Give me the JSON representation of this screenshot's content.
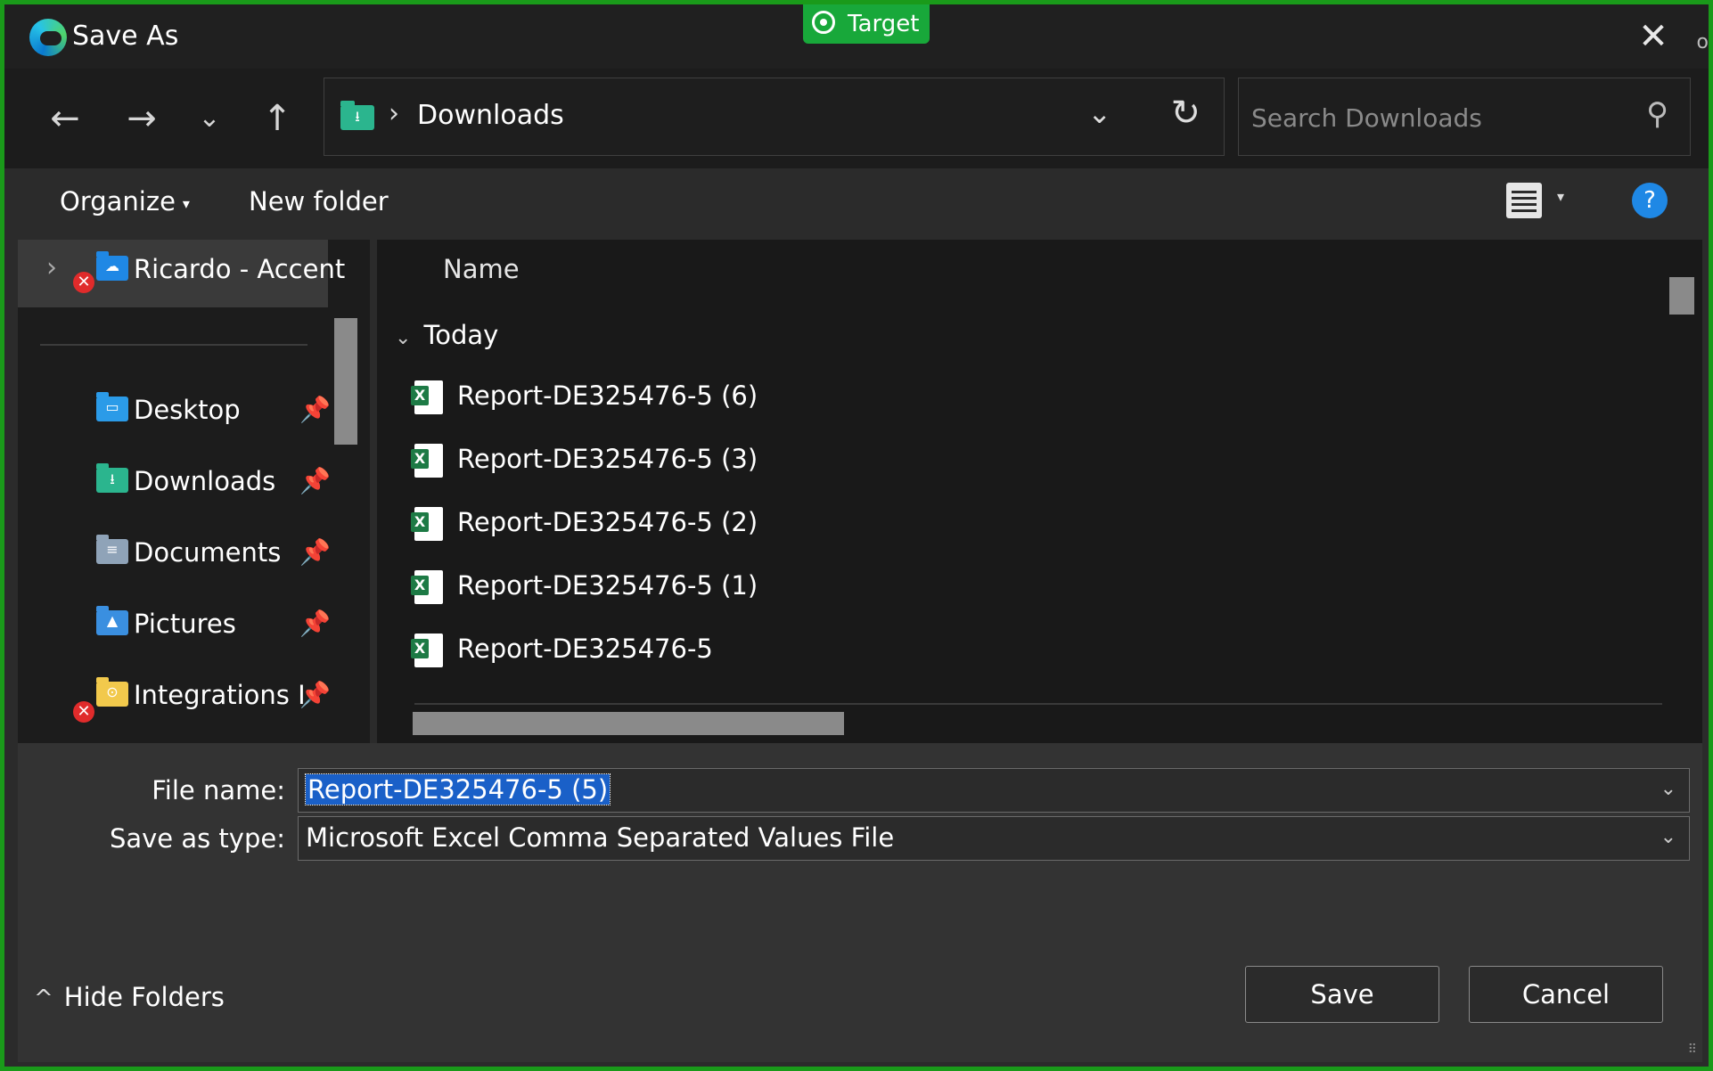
{
  "window": {
    "title": "Save As",
    "close_glyph": "✕",
    "target_badge": "Target",
    "edge_letter": "o"
  },
  "nav": {
    "back_glyph": "←",
    "forward_glyph": "→",
    "recent_glyph": "⌄",
    "up_glyph": "↑",
    "breadcrumb": [
      "Downloads"
    ],
    "crumb_separator": "›",
    "refresh_glyph": "↻",
    "search_placeholder": "Search Downloads"
  },
  "toolbar": {
    "organize_label": "Organize",
    "new_folder_label": "New folder",
    "caret_glyph": "▾",
    "help_glyph": "?"
  },
  "sidebar": {
    "cloud_item": {
      "label": "Ricardo - Accent",
      "error_glyph": "✕",
      "expander_glyph": "›"
    },
    "pin_glyph": "📌",
    "items": [
      {
        "label": "Desktop",
        "icon": "desktop-folder-icon",
        "pinned": true
      },
      {
        "label": "Downloads",
        "icon": "downloads-folder-icon",
        "pinned": true
      },
      {
        "label": "Documents",
        "icon": "documents-folder-icon",
        "pinned": true
      },
      {
        "label": "Pictures",
        "icon": "pictures-folder-icon",
        "pinned": true
      },
      {
        "label": "Integrations I",
        "icon": "shared-folder-icon",
        "pinned": true,
        "error": true
      }
    ]
  },
  "files": {
    "column_name": "Name",
    "group": "Today",
    "group_chevron": "⌄",
    "rows": [
      {
        "name": "Report-DE325476-5 (6)",
        "icon": "excel-file-icon"
      },
      {
        "name": "Report-DE325476-5 (3)",
        "icon": "excel-file-icon"
      },
      {
        "name": "Report-DE325476-5 (2)",
        "icon": "excel-file-icon"
      },
      {
        "name": "Report-DE325476-5 (1)",
        "icon": "excel-file-icon"
      },
      {
        "name": "Report-DE325476-5",
        "icon": "excel-file-icon"
      }
    ]
  },
  "form": {
    "file_name_label": "File name:",
    "file_name_value": "Report-DE325476-5 (5)",
    "save_type_label": "Save as type:",
    "save_type_value": "Microsoft Excel Comma Separated Values File",
    "dropdown_glyph": "⌄"
  },
  "footer": {
    "hide_folders_label": "Hide Folders",
    "hide_folders_glyph": "^",
    "save_label": "Save",
    "cancel_label": "Cancel",
    "grip_glyph": "⠿"
  },
  "colors": {
    "frame": "#1a9a1a",
    "accent": "#1f88e5",
    "selection": "#1a60c8",
    "excel": "#1d7a45",
    "downloads_folder": "#2bb58e",
    "error": "#e02b2b"
  }
}
